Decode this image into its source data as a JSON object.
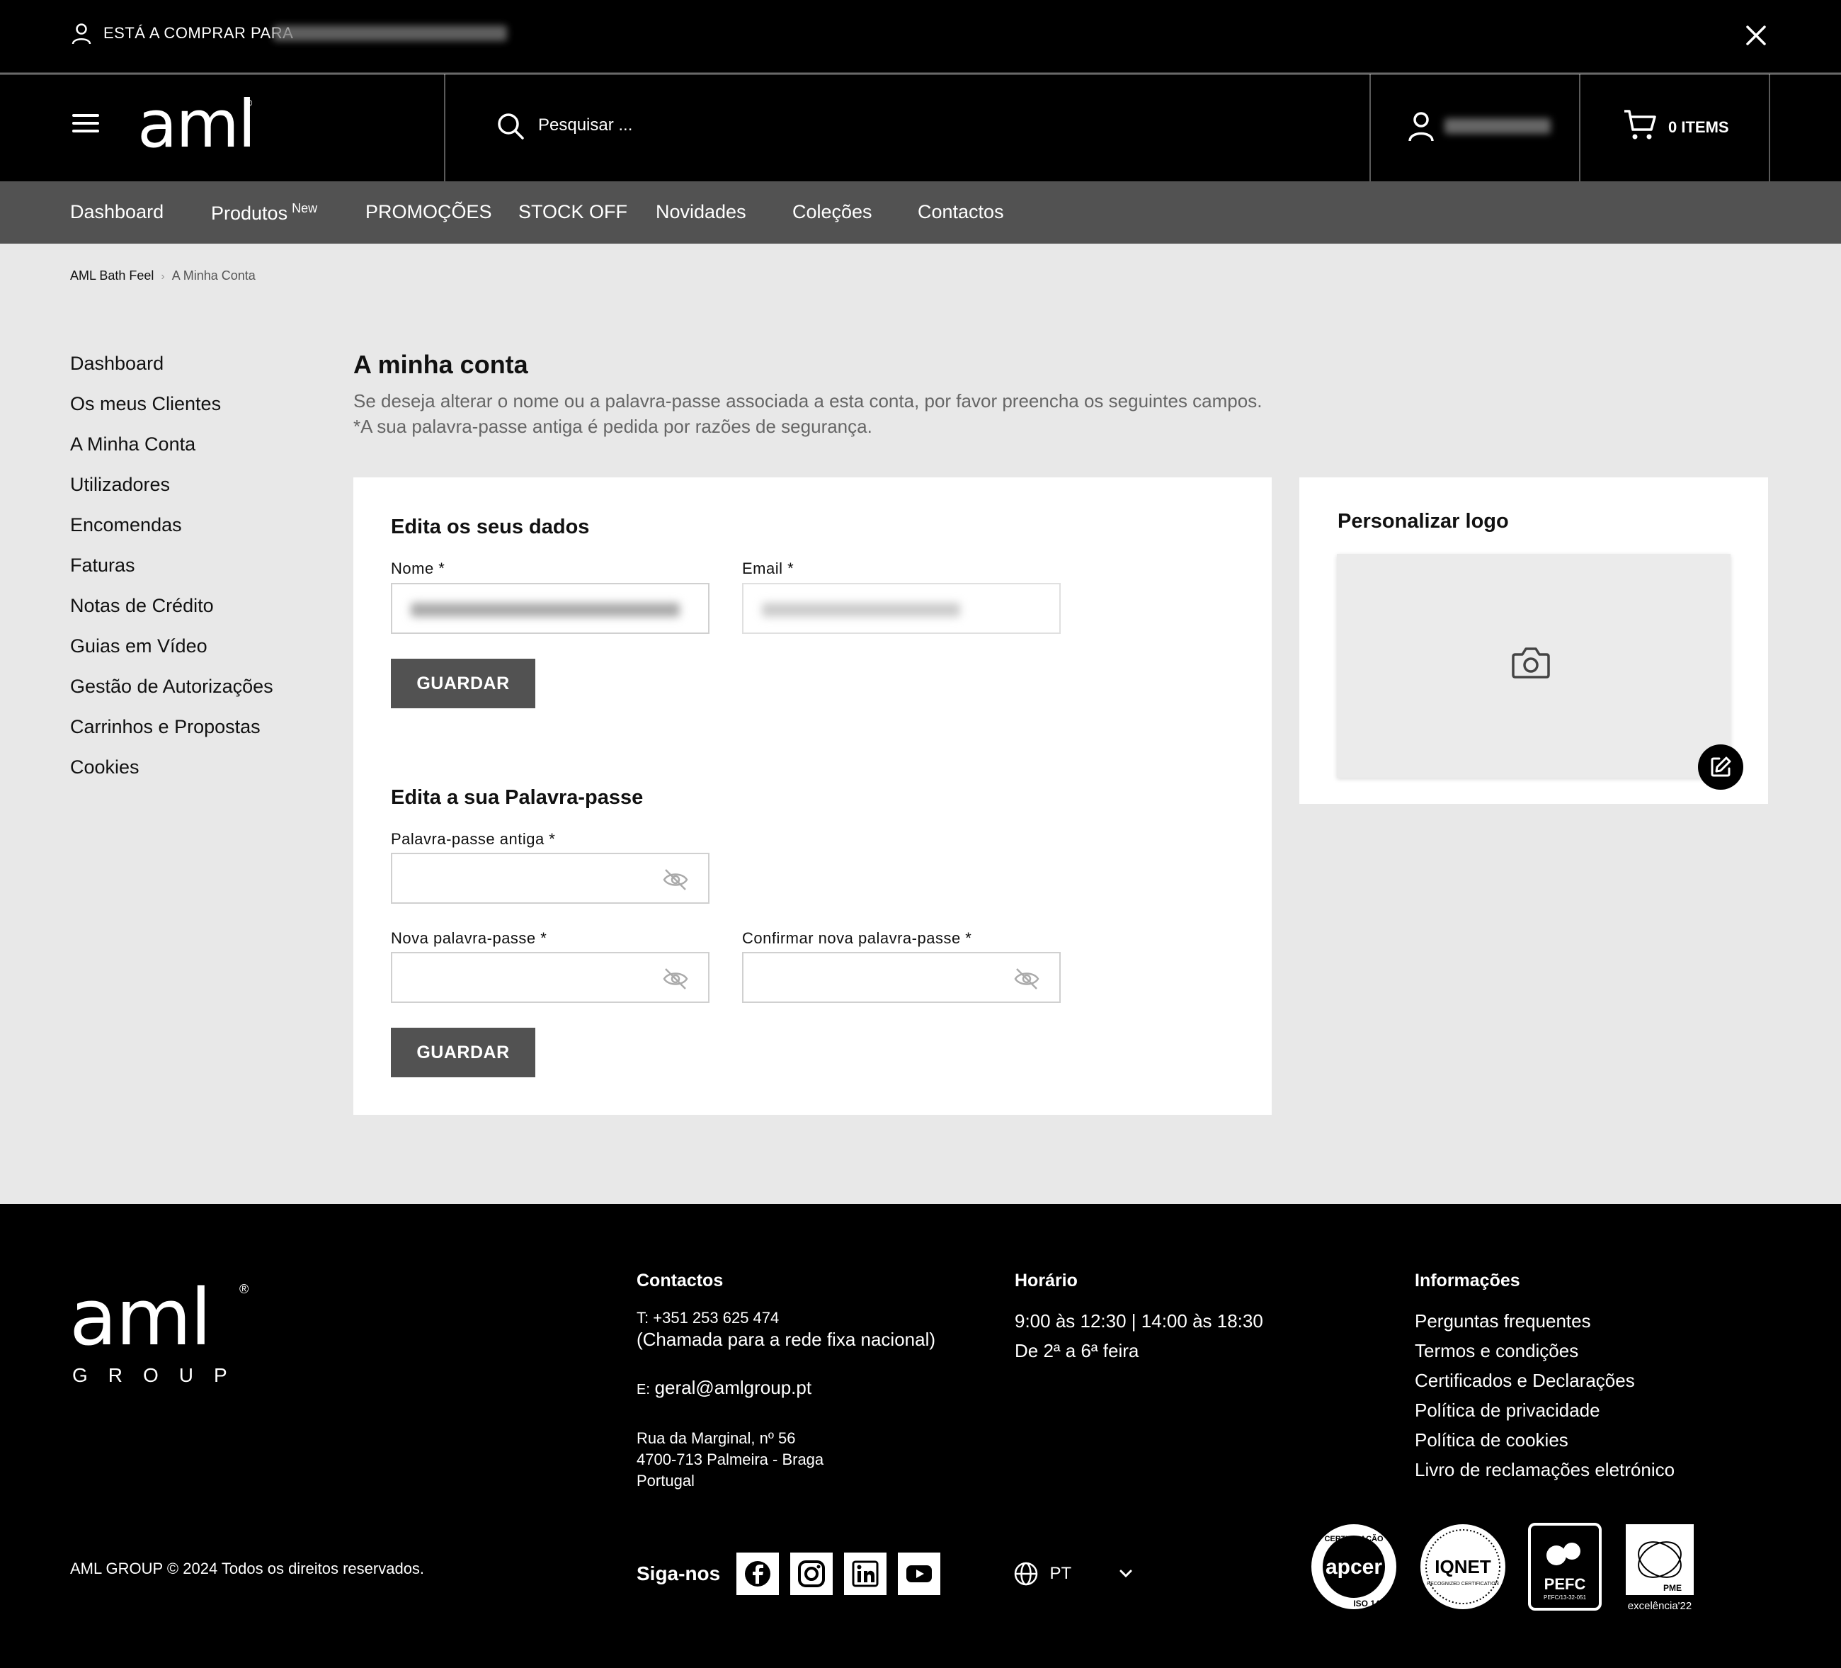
{
  "notice": {
    "text": "ESTÁ A COMPRAR PARA"
  },
  "header": {
    "logo_text": "aml",
    "logo_reg": "®",
    "search_placeholder": "Pesquisar ...",
    "cart_label": "0 ITEMS"
  },
  "nav": {
    "items": [
      {
        "label": "Dashboard"
      },
      {
        "label": "Produtos",
        "badge": "New"
      },
      {
        "label": "PROMOÇÕES"
      },
      {
        "label": "STOCK OFF"
      },
      {
        "label": "Novidades"
      },
      {
        "label": "Coleções"
      },
      {
        "label": "Contactos"
      }
    ]
  },
  "breadcrumb": {
    "home": "AML Bath Feel",
    "sep": "›",
    "current": "A Minha Conta"
  },
  "sidebar": {
    "items": [
      {
        "label": "Dashboard"
      },
      {
        "label": "Os meus Clientes"
      },
      {
        "label": "A Minha Conta"
      },
      {
        "label": "Utilizadores"
      },
      {
        "label": "Encomendas"
      },
      {
        "label": "Faturas"
      },
      {
        "label": "Notas de Crédito"
      },
      {
        "label": "Guias em Vídeo"
      },
      {
        "label": "Gestão de Autorizações"
      },
      {
        "label": "Carrinhos e Propostas"
      },
      {
        "label": "Cookies"
      }
    ]
  },
  "main": {
    "title": "A minha conta",
    "desc_line1": "Se deseja alterar o nome ou a palavra-passe associada a esta conta, por favor preencha os seguintes campos.",
    "desc_line2": "*A sua palavra-passe antiga é pedida por razões de segurança.",
    "profile": {
      "heading": "Edita os seus dados",
      "name_label": "Nome *",
      "email_label": "Email *",
      "save_label": "GUARDAR"
    },
    "password": {
      "heading": "Edita a sua Palavra-passe",
      "old_label": "Palavra-passe antiga *",
      "new_label": "Nova palavra-passe *",
      "confirm_label": "Confirmar nova palavra-passe *",
      "save_label": "GUARDAR"
    },
    "logo_card": {
      "heading": "Personalizar logo"
    }
  },
  "footer": {
    "logo_text": "aml",
    "logo_reg": "®",
    "logo_group": "GROUP",
    "copyright": "AML GROUP © 2024 Todos os direitos reservados.",
    "contacts": {
      "heading": "Contactos",
      "phone_prefix": "T:",
      "phone": "+351 253 625 474",
      "phone_note": "(Chamada para a rede fixa nacional)",
      "email_prefix": "E:",
      "email": "geral@amlgroup.pt",
      "address1": "Rua da Marginal, nº 56",
      "address2": "4700-713 Palmeira - Braga",
      "address3": "Portugal"
    },
    "hours": {
      "heading": "Horário",
      "line1": "9:00 às 12:30 | 14:00 às 18:30",
      "line2": "De 2ª a 6ª feira"
    },
    "info": {
      "heading": "Informações",
      "links": [
        {
          "label": "Perguntas frequentes"
        },
        {
          "label": "Termos e condições"
        },
        {
          "label": "Certificados e Declarações"
        },
        {
          "label": "Política de privacidade"
        },
        {
          "label": "Política de cookies"
        },
        {
          "label": "Livro de reclamações eletrónico"
        }
      ]
    },
    "follow_label": "Siga-nos",
    "language": "PT",
    "certs": {
      "apcer": "apcer",
      "apcer_top": "CERTIFICAÇÃO",
      "apcer_iso": "ISO 14001",
      "iqnet": "IQNET",
      "iqnet_sub": "RECOGNIZED CERTIFICATION",
      "pefc": "PEFC",
      "pefc_code": "PEFC/13-32-051",
      "pme": "PME",
      "pme_sub": "excelência'22"
    }
  }
}
